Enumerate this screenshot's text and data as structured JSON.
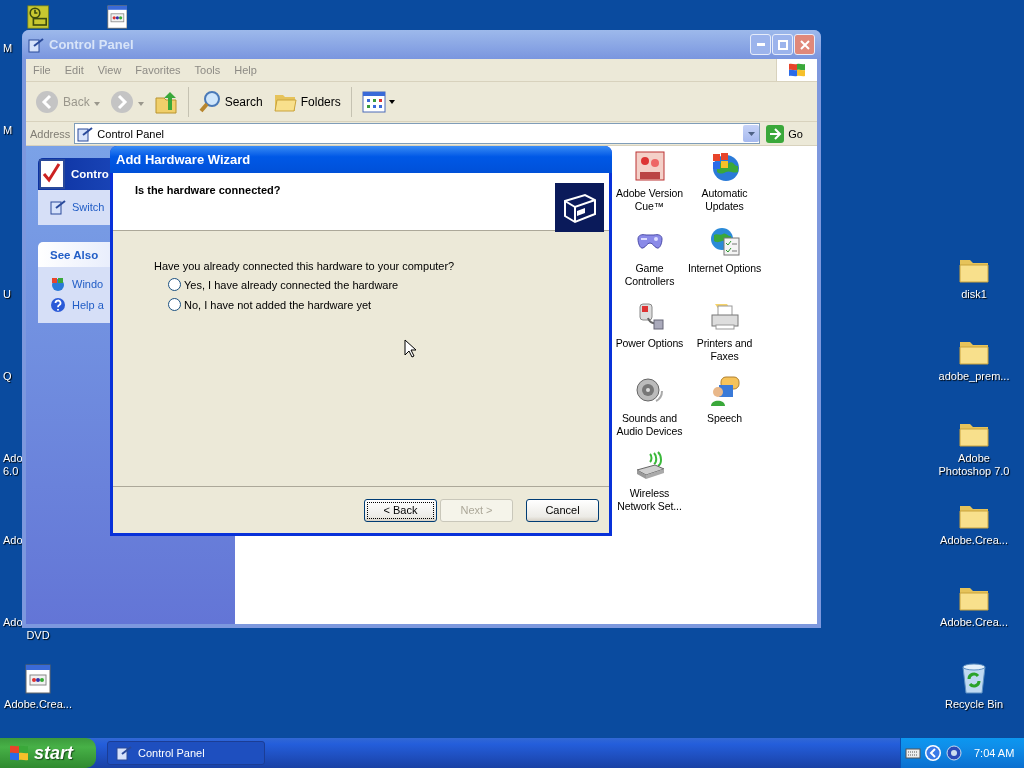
{
  "desktop": {
    "left_icons": [
      {
        "kind": "yellow-app",
        "lines": [
          "M"
        ]
      },
      {
        "kind": "covered",
        "lines": [
          "M"
        ]
      },
      {
        "kind": "covered"
      },
      {
        "kind": "covered",
        "lines": [
          "U"
        ]
      },
      {
        "kind": "covered",
        "lines": [
          "Q"
        ]
      },
      {
        "kind": "covered",
        "lines": [
          "Ado",
          "6.0"
        ]
      },
      {
        "kind": "covered",
        "lines": [
          "Ado"
        ]
      },
      {
        "kind": "covered",
        "lines": [
          "Ado"
        ],
        "tail": "DVD"
      },
      {
        "kind": "app",
        "label": "Adobe.Crea..."
      }
    ],
    "second_column": [
      {
        "kind": "app"
      }
    ],
    "right_icons": [
      {
        "kind": "folder",
        "label": "disk1"
      },
      {
        "kind": "folder",
        "label": "adobe_prem..."
      },
      {
        "kind": "folder",
        "label": "Adobe Photoshop 7.0"
      },
      {
        "kind": "folder",
        "label": "Adobe.Crea..."
      },
      {
        "kind": "folder",
        "label": "Adobe.Crea..."
      },
      {
        "kind": "recycle",
        "label": "Recycle Bin"
      }
    ]
  },
  "window": {
    "title": "Control Panel",
    "active": false,
    "menu": [
      "File",
      "Edit",
      "View",
      "Favorites",
      "Tools",
      "Help"
    ],
    "toolbar": [
      {
        "kind": "back",
        "label": "Back",
        "disabled": true
      },
      {
        "kind": "forward",
        "disabled": true
      },
      {
        "kind": "up"
      },
      {
        "kind": "separator"
      },
      {
        "kind": "search",
        "label": "Search"
      },
      {
        "kind": "folders",
        "label": "Folders"
      },
      {
        "kind": "separator"
      },
      {
        "kind": "views"
      }
    ],
    "address": {
      "label": "Address",
      "value": "Control Panel",
      "go": "Go"
    },
    "task_panes": [
      {
        "kind": "main",
        "title": "Contro",
        "items": [
          "Switch"
        ]
      },
      {
        "kind": "see-also",
        "title": "See Also",
        "items": [
          "Windo",
          "Help a"
        ]
      }
    ],
    "items": [
      {
        "kind": "version-cue",
        "label": "Adobe Version Cue™"
      },
      {
        "kind": "updates",
        "label": "Automatic Updates"
      },
      {
        "kind": "gamepad",
        "label": "Game Controllers"
      },
      {
        "kind": "internet",
        "label": "Internet Options"
      },
      {
        "kind": "power",
        "label": "Power Options"
      },
      {
        "kind": "printer",
        "label": "Printers and Faxes"
      },
      {
        "kind": "speaker",
        "label": "Sounds and Audio Devices"
      },
      {
        "kind": "speech",
        "label": "Speech"
      },
      {
        "kind": "wireless",
        "label": "Wireless Network Set..."
      }
    ]
  },
  "dialog": {
    "title": "Add Hardware Wizard",
    "heading": "Is the hardware connected?",
    "question": "Have you already connected this hardware to your computer?",
    "options": [
      {
        "label": "Yes, I have already connected the hardware",
        "selected": false
      },
      {
        "label": "No, I have not added the hardware yet",
        "selected": false
      }
    ],
    "buttons": [
      {
        "label": "< Back",
        "disabled": false,
        "focused": true
      },
      {
        "label": "Next >",
        "disabled": true,
        "focused": false
      },
      {
        "label": "Cancel",
        "disabled": false,
        "focused": false
      }
    ]
  },
  "taskbar": {
    "start": "start",
    "tasks": [
      {
        "label": "Control Panel",
        "selected": true
      }
    ],
    "clock": "7:04 AM"
  }
}
